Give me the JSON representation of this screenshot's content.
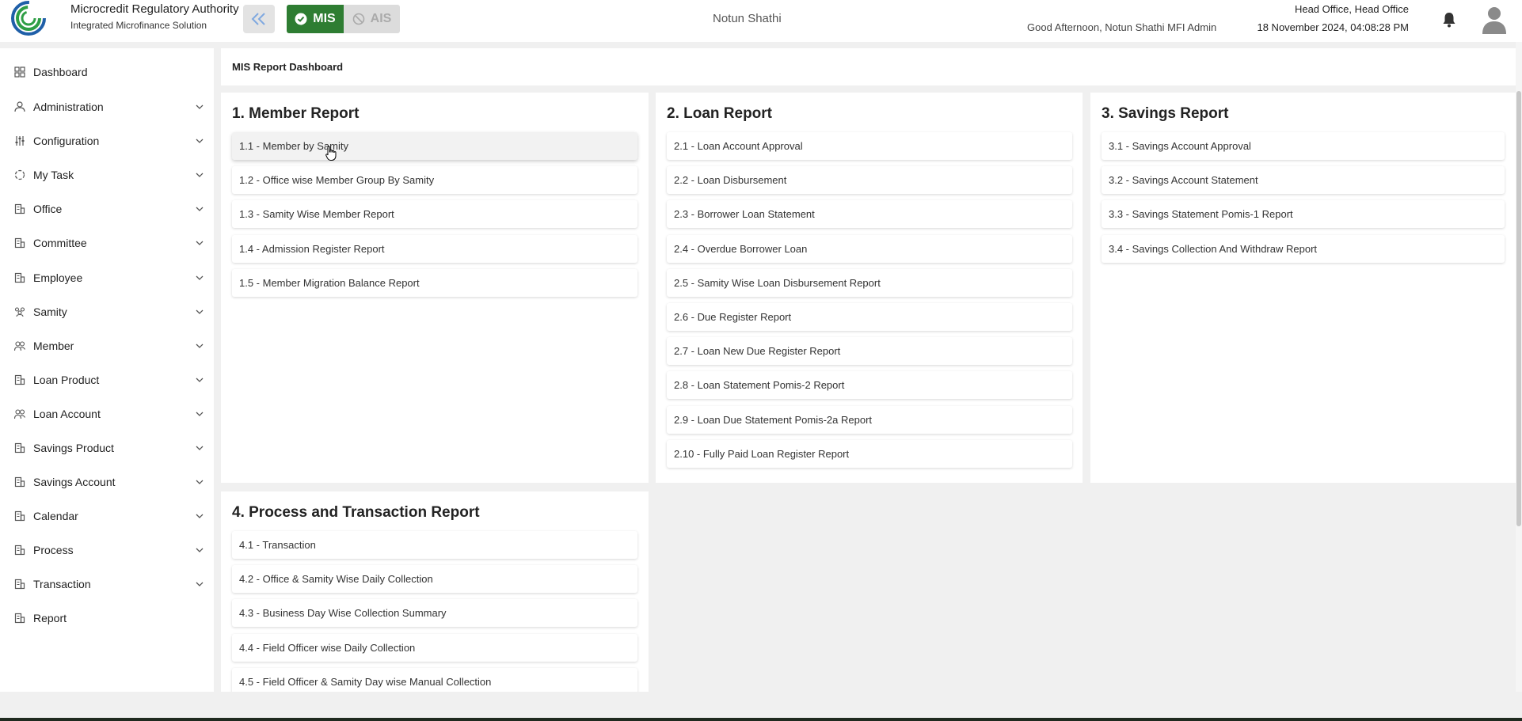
{
  "header": {
    "app_title": "Microcredit Regulatory Authority",
    "app_subtitle": "Integrated Microfinance Solution",
    "logo_text": "Microcredit Regulatory Authority",
    "mis_label": "MIS",
    "ais_label": "AIS",
    "org_name": "Notun Shathi",
    "greeting": "Good Afternoon, Notun Shathi MFI Admin",
    "office": "Head Office, Head Office",
    "datetime": "18 November 2024, 04:08:28 PM"
  },
  "sidebar": {
    "items": [
      {
        "label": "Dashboard",
        "icon": "grid-icon",
        "expandable": false
      },
      {
        "label": "Administration",
        "icon": "admin-icon",
        "expandable": true
      },
      {
        "label": "Configuration",
        "icon": "sliders-icon",
        "expandable": true
      },
      {
        "label": "My Task",
        "icon": "task-icon",
        "expandable": true
      },
      {
        "label": "Office",
        "icon": "building-icon",
        "expandable": true
      },
      {
        "label": "Committee",
        "icon": "building-icon",
        "expandable": true
      },
      {
        "label": "Employee",
        "icon": "building-icon",
        "expandable": true
      },
      {
        "label": "Samity",
        "icon": "group-icon",
        "expandable": true
      },
      {
        "label": "Member",
        "icon": "users-icon",
        "expandable": true
      },
      {
        "label": "Loan Product",
        "icon": "building-icon",
        "expandable": true
      },
      {
        "label": "Loan Account",
        "icon": "users-icon",
        "expandable": true
      },
      {
        "label": "Savings Product",
        "icon": "building-icon",
        "expandable": true
      },
      {
        "label": "Savings Account",
        "icon": "building-icon",
        "expandable": true
      },
      {
        "label": "Calendar",
        "icon": "building-icon",
        "expandable": true
      },
      {
        "label": "Process",
        "icon": "building-icon",
        "expandable": true
      },
      {
        "label": "Transaction",
        "icon": "building-icon",
        "expandable": true
      },
      {
        "label": "Report",
        "icon": "building-icon",
        "expandable": false
      }
    ]
  },
  "main": {
    "page_title": "MIS Report Dashboard",
    "sections": [
      {
        "title": "1. Member Report",
        "items": [
          "1.1 - Member by Samity",
          "1.2 - Office wise Member Group By Samity",
          "1.3 - Samity Wise Member Report",
          "1.4 - Admission Register Report",
          "1.5 - Member Migration Balance Report"
        ]
      },
      {
        "title": "2. Loan Report",
        "items": [
          "2.1 - Loan Account Approval",
          "2.2 - Loan Disbursement",
          "2.3 - Borrower Loan Statement",
          "2.4 - Overdue Borrower Loan",
          "2.5 - Samity Wise Loan Disbursement Report",
          "2.6 - Due Register Report",
          "2.7 - Loan New Due Register Report",
          "2.8 - Loan Statement Pomis-2 Report",
          "2.9 - Loan Due Statement Pomis-2a Report",
          "2.10 - Fully Paid Loan Register Report"
        ]
      },
      {
        "title": "3. Savings Report",
        "items": [
          "3.1 - Savings Account Approval",
          "3.2 - Savings Account Statement",
          "3.3 - Savings Statement Pomis-1 Report",
          "3.4 - Savings Collection And Withdraw Report"
        ]
      },
      {
        "title": "4. Process and Transaction Report",
        "items": [
          "4.1 - Transaction",
          "4.2 - Office & Samity Wise Daily Collection",
          "4.3 - Business Day Wise Collection Summary",
          "4.4 - Field Officer wise Daily Collection",
          "4.5 - Field Officer & Samity Day wise Manual Collection"
        ]
      }
    ]
  },
  "colors": {
    "mis_active": "#2e7d32",
    "ais_inactive": "#dcdcdc",
    "logo_green": "#2e9e45",
    "logo_blue": "#1f5fa8"
  }
}
